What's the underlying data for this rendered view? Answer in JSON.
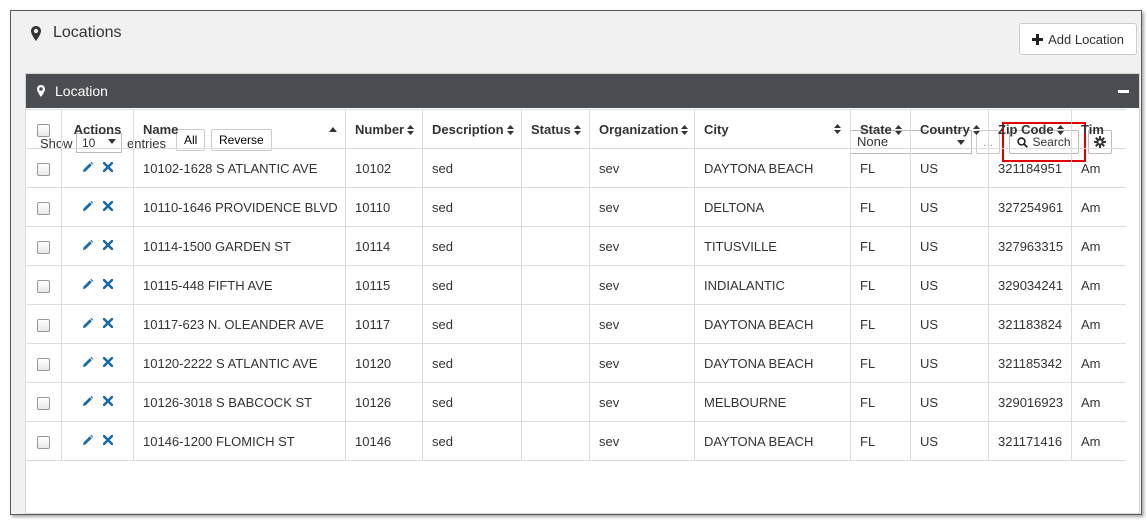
{
  "page": {
    "title": "Locations",
    "add_button": "Add Location"
  },
  "panel": {
    "title": "Location"
  },
  "toolbar": {
    "show_label": "Show",
    "page_size": "10",
    "entries_label": "entries",
    "all_button": "All",
    "reverse_button": "Reverse",
    "filter_value": "None",
    "ellipsis_button": "...",
    "search_button": "Search"
  },
  "table": {
    "columns": [
      "",
      "Actions",
      "Name",
      "Number",
      "Description",
      "Status",
      "Organization",
      "City",
      "State",
      "Country",
      "Zip Code",
      "Tim"
    ],
    "rows": [
      {
        "name": "10102-1628 S ATLANTIC AVE",
        "number": "10102",
        "description": "sed",
        "status": "",
        "organization": "sev",
        "city": "DAYTONA BEACH",
        "state": "FL",
        "country": "US",
        "zip": "321184951",
        "tim": "Am"
      },
      {
        "name": "10110-1646 PROVIDENCE BLVD",
        "number": "10110",
        "description": "sed",
        "status": "",
        "organization": "sev",
        "city": "DELTONA",
        "state": "FL",
        "country": "US",
        "zip": "327254961",
        "tim": "Am"
      },
      {
        "name": "10114-1500 GARDEN ST",
        "number": "10114",
        "description": "sed",
        "status": "",
        "organization": "sev",
        "city": "TITUSVILLE",
        "state": "FL",
        "country": "US",
        "zip": "327963315",
        "tim": "Am"
      },
      {
        "name": "10115-448 FIFTH AVE",
        "number": "10115",
        "description": "sed",
        "status": "",
        "organization": "sev",
        "city": "INDIALANTIC",
        "state": "FL",
        "country": "US",
        "zip": "329034241",
        "tim": "Am"
      },
      {
        "name": "10117-623 N. OLEANDER AVE",
        "number": "10117",
        "description": "sed",
        "status": "",
        "organization": "sev",
        "city": "DAYTONA BEACH",
        "state": "FL",
        "country": "US",
        "zip": "321183824",
        "tim": "Am"
      },
      {
        "name": "10120-2222 S ATLANTIC AVE",
        "number": "10120",
        "description": "sed",
        "status": "",
        "organization": "sev",
        "city": "DAYTONA BEACH",
        "state": "FL",
        "country": "US",
        "zip": "321185342",
        "tim": "Am"
      },
      {
        "name": "10126-3018 S BABCOCK ST",
        "number": "10126",
        "description": "sed",
        "status": "",
        "organization": "sev",
        "city": "MELBOURNE",
        "state": "FL",
        "country": "US",
        "zip": "329016923",
        "tim": "Am"
      },
      {
        "name": "10146-1200 FLOMICH ST",
        "number": "10146",
        "description": "sed",
        "status": "",
        "organization": "sev",
        "city": "DAYTONA BEACH",
        "state": "FL",
        "country": "US",
        "zip": "321171416",
        "tim": "Am"
      }
    ]
  },
  "colors": {
    "panel_header": "#4a4d52",
    "action_icon": "#1a6aa8",
    "highlight": "#e00000"
  },
  "icons": {
    "title": "map-marker-icon",
    "add": "plus-icon",
    "search": "magnifier-icon",
    "settings": "gear-icon",
    "edit": "pencil-icon",
    "delete": "x-icon",
    "collapse": "minus-icon"
  }
}
